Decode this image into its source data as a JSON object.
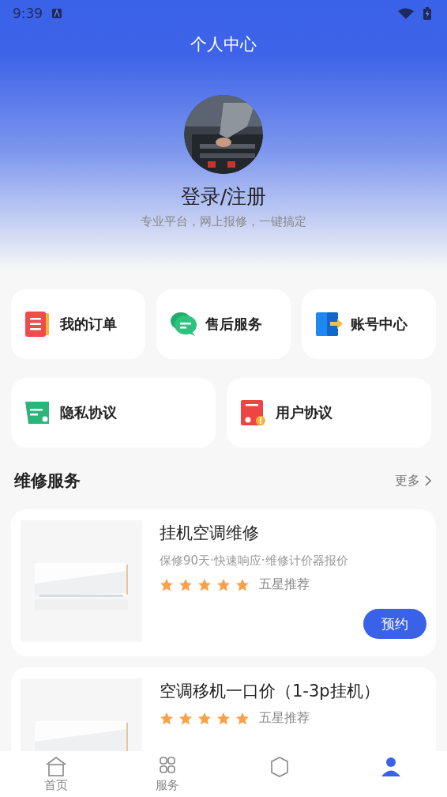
{
  "status_bar": {
    "time": "9:39"
  },
  "header": {
    "title": "个人中心",
    "login": "登录/注册",
    "subtitle": "专业平台，网上报修，一键搞定"
  },
  "shortcuts": [
    {
      "label": "我的订单",
      "kind": "order"
    },
    {
      "label": "售后服务",
      "kind": "chat"
    },
    {
      "label": "账号中心",
      "kind": "account"
    },
    {
      "label": "隐私协议",
      "kind": "privacy"
    },
    {
      "label": "用户协议",
      "kind": "agreement"
    }
  ],
  "section": {
    "title": "维修服务",
    "more": "更多"
  },
  "services": [
    {
      "title": "挂机空调维修",
      "desc": "保修90天·快速响应·维修计价器报价",
      "stars": 5,
      "rating": "五星推荐",
      "button": "预约"
    },
    {
      "title": "空调移机一口价（1-3p挂机）",
      "stars": 5,
      "rating": "五星推荐"
    }
  ],
  "bottom_nav": [
    {
      "label": "首页",
      "kind": "home",
      "selected": false
    },
    {
      "label": "服务",
      "kind": "grid",
      "selected": false
    },
    {
      "kind": "box",
      "selected": false
    },
    {
      "kind": "user",
      "selected": true
    }
  ]
}
